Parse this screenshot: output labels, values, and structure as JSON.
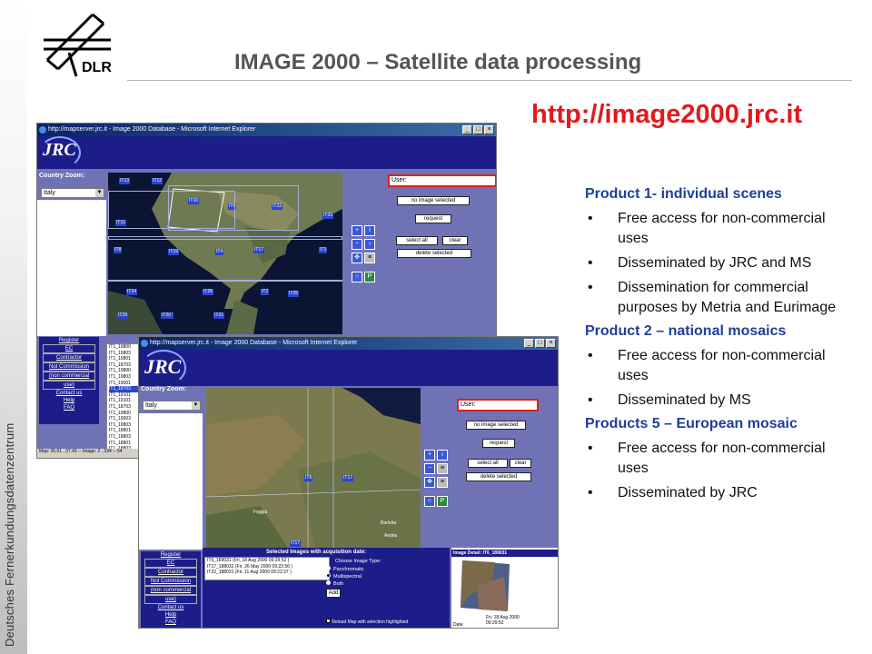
{
  "slide": {
    "title": "IMAGE 2000 – Satellite data processing",
    "url": "http://image2000.jrc.it",
    "sidebar_text": "Deutsches Fernerkundungsdatenzentrum",
    "logo_text": "DLR"
  },
  "products": [
    {
      "heading": "Product 1- individual scenes",
      "bullets": [
        "Free access for non-commercial uses",
        "Disseminated by JRC and MS",
        "Dissemination for commercial purposes by Metria and Eurimage"
      ]
    },
    {
      "heading": "Product 2 – national mosaics",
      "bullets": [
        "Free access for non-commercial uses",
        "Disseminated by MS"
      ]
    },
    {
      "heading": "Products 5 – European mosaic",
      "bullets": [
        "Free access for non-commercial uses",
        "Disseminated by JRC"
      ]
    }
  ],
  "win1": {
    "title": "http://mapserver.jrc.it - Image 2000 Database - Microsoft Internet Explorer",
    "logo": "JRC",
    "country_zoom_label": "Country Zoom:",
    "country_value": "Italy",
    "user_label": "User:",
    "no_image_label": "no image selected",
    "request_label": "request",
    "select_all_label": "select all",
    "clear_label": "clear",
    "delete_selected_label": "delete selected",
    "nav": [
      "Register",
      "EC",
      "Contractor",
      "Not Commission",
      "(non commercial",
      "use)",
      "Contact us",
      "Help",
      "FAQ"
    ],
    "list": [
      "IT1_19800",
      "IT1_19803",
      "IT1_19801",
      "IT1_18703",
      "IT1_19800",
      "IT1_19803",
      "IT1_19001",
      "IT1_18703",
      "IT1_19101",
      "IT1_19101",
      "IT1_18703",
      "IT1_19800",
      "IT1_19003",
      "IT1_19803",
      "IT1_18801",
      "IT1_18803",
      "IT1_18801",
      "IT1_18803",
      "IT1_18800"
    ],
    "status": "Map: 35.51 , 37.43 -- Image: 2 , 334 -- 54",
    "tiles": [
      "IT13",
      "IT12",
      "IT11",
      "IT10",
      "IT6",
      "IT22",
      "IT8",
      "IT19",
      "IT4",
      "IT17",
      "IT1",
      "IT24",
      "IT26",
      "IT2",
      "IT29",
      "IT27",
      "IT21",
      "IT33",
      "IT25",
      "IT20"
    ]
  },
  "win2": {
    "title": "http://mapserver.jrc.it - Image 2000 Database - Microsoft Internet Explorer",
    "logo": "JRC",
    "country_zoom_label": "Country Zoom:",
    "country_value": "Italy",
    "user_label": "User:",
    "no_image_label": "no image selected",
    "request_label": "request",
    "select_all_label": "select all",
    "clear_label": "clear",
    "delete_selected_label": "delete selected",
    "nav": [
      "Register",
      "EC",
      "Contractor",
      "Not Commission",
      "(non commercial",
      "use)",
      "Contact us",
      "Help",
      "FAQ"
    ],
    "tiles": [
      "IT6",
      "IT17",
      "IT17"
    ],
    "places": [
      "Foggia",
      "Barletta",
      "Andria"
    ],
    "selected_header": "Selected Images with acquisition date:",
    "selected_items": [
      "IT6_189031 (Fri, 18 Aug 2000 09:29:52 )",
      "IT17_188032 (Fri, 26 May 2000 09:22:56 )",
      "IT22_188031 (Fri, 11 Aug 2000 09:22:37 )"
    ],
    "choose_type_label": "Choose Image Type:",
    "types": [
      "Panchromatic",
      "Multispectral",
      "Both"
    ],
    "add_label": "Add",
    "reload_label": "Reload Map with selection highlighted",
    "detail_header": "Image Detail: IT6_189031",
    "detail_date_label": "Date",
    "detail_date_value": "Fri, 18 Aug 2000 09:29:52"
  },
  "colors": {
    "title": "#555555",
    "url": "#e3181b",
    "heading": "#1f3f9a",
    "app_bg": "#6f73b6",
    "banner": "#1d1d8a"
  }
}
